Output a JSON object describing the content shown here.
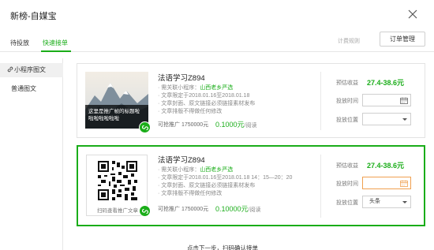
{
  "window": {
    "title": "新榜-自媒宝"
  },
  "tabs": [
    {
      "label": "待投放"
    },
    {
      "label": "快速接单"
    }
  ],
  "header": {
    "rules_label": "计费规则",
    "order_button": "订单管理"
  },
  "sidebar": {
    "items": [
      {
        "label": "小程序图文"
      },
      {
        "label": "普通图文"
      }
    ]
  },
  "cards": [
    {
      "title": "法语学习Z894",
      "thumb_caption": "这里是推广帧的标题啦 啦啦啦啦啦啦",
      "bullets": [
        {
          "prefix": "· 需关联小程序：",
          "highlight": "山西老乡严选"
        },
        {
          "prefix": "· 文章限定于2018.01.16至2018.01.18",
          "highlight": ""
        },
        {
          "prefix": "· 文章封面、原文链接必须链接素材发布",
          "highlight": ""
        },
        {
          "prefix": "· 文章排版不得做任何修改",
          "highlight": ""
        }
      ],
      "available_label": "可抢推广 1750000元",
      "price_value": "0.1000元",
      "price_unit": "/阅读",
      "estimate_label": "预估收益",
      "estimate_value": "27.4-38.6元",
      "time_label": "投放时间",
      "time_value": "",
      "position_label": "投放位置",
      "position_value": ""
    },
    {
      "title": "法语学习Z894",
      "qr_caption": "扫码查看推广文章",
      "bullets": [
        {
          "prefix": "· 需关联小程序：",
          "highlight": "山西老乡严选"
        },
        {
          "prefix": "· 文章限定于2018.01.16至2018.01.18  14：15—20：20",
          "highlight": ""
        },
        {
          "prefix": "· 文章封面、原文链接必须链接素材发布",
          "highlight": ""
        },
        {
          "prefix": "· 文章排版不得做任何修改",
          "highlight": ""
        }
      ],
      "available_label": "可抢推广 1750000元",
      "price_value": "0.10000元",
      "price_unit": "/阅读",
      "estimate_label": "预估收益",
      "estimate_value": "27.4-38.6元",
      "time_label": "投放时间",
      "time_value": "",
      "position_label": "投放位置",
      "position_value": "头条"
    }
  ],
  "footer": {
    "hint": "点击下一步，扫码确认接单"
  },
  "colors": {
    "accent": "#1aad19",
    "active_border": "#f0a050"
  }
}
